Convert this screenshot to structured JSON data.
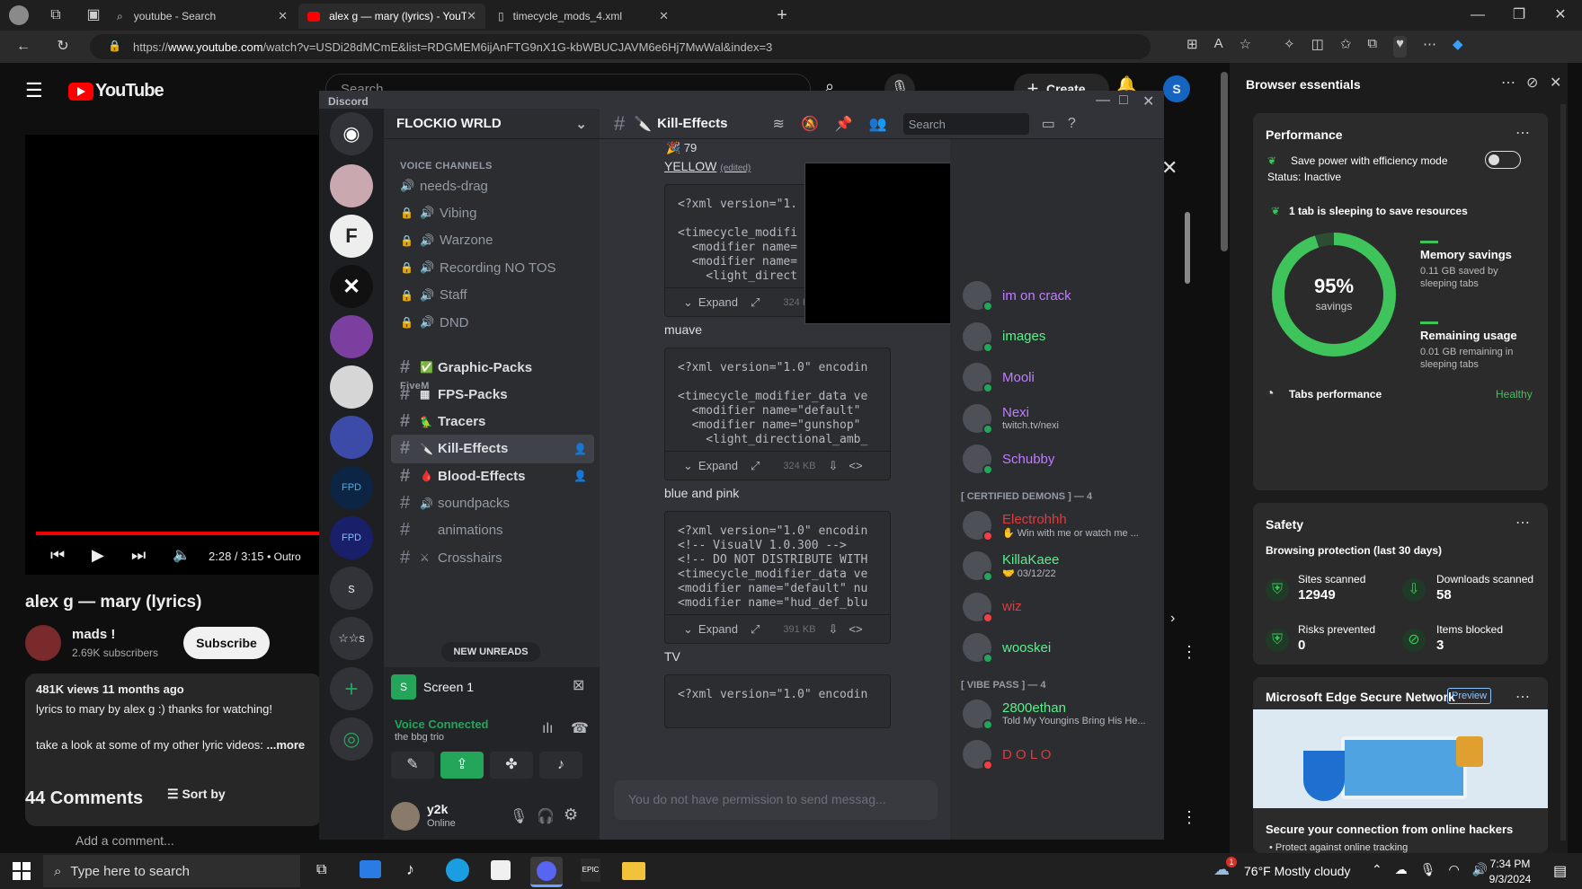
{
  "browser": {
    "tabs": [
      {
        "title": "youtube - Search",
        "icon": "search-icon"
      },
      {
        "title": "alex g — mary (lyrics) - YouTube",
        "icon": "youtube-icon"
      },
      {
        "title": "timecycle_mods_4.xml",
        "icon": "document-icon"
      }
    ],
    "url_prefix": "https://",
    "url_host": "www.youtube.com",
    "url_path": "/watch?v=USDi28dMCmE&list=RDGMEM6ijAnFTG9nX1G-kbWBUCJAVM6e6Hj7MwWal&index=3"
  },
  "youtube": {
    "logo": "YouTube",
    "search_placeholder": "Search",
    "create_label": "Create",
    "avatar_letter": "S",
    "time": "2:28 / 3:15",
    "chapter": "• Outro",
    "title": "alex g — mary (lyrics)",
    "channel": "mads !",
    "subscribers": "2.69K subscribers",
    "subscribe": "Subscribe",
    "views": "481K views  11 months ago",
    "desc1": "lyrics to mary by alex g :) thanks for watching!",
    "desc2": "take a look at some of my other lyric videos:",
    "more": "...more",
    "comments": "44 Comments",
    "sort": "Sort by",
    "add_comment": "Add a comment..."
  },
  "discord": {
    "app": "Discord",
    "server": "FLOCKIO WRLD",
    "voice_cat": "VOICE CHANNELS",
    "voice": [
      {
        "name": "needs-drag",
        "locked": false
      },
      {
        "name": "Vibing",
        "locked": true
      },
      {
        "name": "Warzone",
        "locked": true
      },
      {
        "name": "Recording NO TOS",
        "locked": true
      },
      {
        "name": "Staff",
        "locked": true
      },
      {
        "name": "DND",
        "locked": true
      }
    ],
    "fivem_cat": "FiveM",
    "text": [
      {
        "name": "Graphic-Packs",
        "emoji": "✅"
      },
      {
        "name": "FPS-Packs",
        "emoji": "▦"
      },
      {
        "name": "Tracers",
        "emoji": "🦜"
      },
      {
        "name": "Kill-Effects",
        "emoji": "🔪"
      },
      {
        "name": "Blood-Effects",
        "emoji": "🩸"
      },
      {
        "name": "soundpacks",
        "emoji": "🔊"
      },
      {
        "name": "animations",
        "emoji": ""
      },
      {
        "name": "Crosshairs",
        "emoji": "⚔"
      }
    ],
    "new_unreads": "NEW UNREADS",
    "screen": "Screen 1",
    "voice_connected": "Voice Connected",
    "voice_sub": "the bbg trio",
    "user": "y2k",
    "status": "Online",
    "channel_title": "Kill-Effects",
    "search": "Search",
    "reaction_count": "79",
    "messages": [
      {
        "label": "YELLOW",
        "edited": "(edited)",
        "size": "324 KB",
        "lines": [
          "<?xml version=\"1.",
          "",
          "<timecycle_modifi",
          "  <modifier name=",
          "  <modifier name=",
          "    <light_direct"
        ]
      },
      {
        "label": "muave",
        "size": "324 KB",
        "lines": [
          "<?xml version=\"1.0\" encodin",
          "",
          "<timecycle_modifier_data ve",
          "  <modifier name=\"default\"",
          "  <modifier name=\"gunshop\"",
          "    <light_directional_amb_"
        ]
      },
      {
        "label": "blue and pink",
        "size": "391 KB",
        "lines": [
          "<?xml version=\"1.0\" encodin",
          "<!-- VisualV 1.0.300 -->",
          "<!-- DO NOT DISTRIBUTE WITH",
          "<timecycle_modifier_data ve",
          "<modifier name=\"default\" nu",
          "<modifier name=\"hud_def_blu"
        ]
      },
      {
        "label": "TV",
        "size": "",
        "lines": [
          "<?xml version=\"1.0\" encodin"
        ]
      }
    ],
    "expand": "Expand",
    "composer": "You do not have permission to send messag...",
    "members": [
      {
        "name": "im on crack",
        "sub": "",
        "color": "#c27cff"
      },
      {
        "name": "images",
        "sub": "",
        "color": "#57f287"
      },
      {
        "name": "Mooli",
        "sub": "",
        "color": "#c27cff"
      },
      {
        "name": "Nexi",
        "sub": "twitch.tv/nexi",
        "color": "#c27cff"
      },
      {
        "name": "Schubby",
        "sub": "",
        "color": "#c27cff"
      }
    ],
    "cert_header": "[ CERTIFIED DEMONS ] — 4",
    "cert": [
      {
        "name": "Electrohhh",
        "sub": "✋ Win with me or watch me ...",
        "color": "#e03c3c"
      },
      {
        "name": "KillaKaee",
        "sub": "🤝 03/12/22",
        "color": "#57f287"
      },
      {
        "name": "wiz",
        "sub": "",
        "color": "#e03c3c"
      },
      {
        "name": "wooskei",
        "sub": "",
        "color": "#57f287"
      }
    ],
    "vibe_header": "[ VIBE PASS ] — 4",
    "vibe": [
      {
        "name": "2800ethan",
        "sub": "Told My Youngins Bring His He...",
        "color": "#57f287"
      },
      {
        "name": "D O L O",
        "sub": "",
        "color": "#e03c3c"
      }
    ]
  },
  "essentials": {
    "title": "Browser essentials",
    "perf_title": "Performance",
    "power": "Save power with efficiency mode",
    "status": "Status: Inactive",
    "sleeping": "1 tab is sleeping to save resources",
    "percent": "95%",
    "savings_word": "savings",
    "savings_fraction": 0.95,
    "mem_title": "Memory savings",
    "mem_sub1": "0.11 GB saved by",
    "mem_sub2": "sleeping tabs",
    "rem_title": "Remaining usage",
    "rem_sub1": "0.01 GB remaining in",
    "rem_sub2": "sleeping tabs",
    "tabs_perf": "Tabs performance",
    "healthy": "Healthy",
    "safety_title": "Safety",
    "browsing": "Browsing protection (last 30 days)",
    "sites_label": "Sites scanned",
    "sites": "12949",
    "downloads_label": "Downloads scanned",
    "downloads": "58",
    "risks_label": "Risks prevented",
    "risks": "0",
    "blocked_label": "Items blocked",
    "blocked": "3",
    "network_title": "Microsoft Edge Secure Network",
    "preview": "Preview",
    "secure": "Secure your connection from online hackers",
    "bullet": "Protect against online tracking",
    "accent": "#3ec45a"
  },
  "taskbar": {
    "search": "Type here to search",
    "weather": "76°F  Mostly cloudy",
    "time": "7:34 PM",
    "date": "9/3/2024",
    "notif": "1"
  }
}
